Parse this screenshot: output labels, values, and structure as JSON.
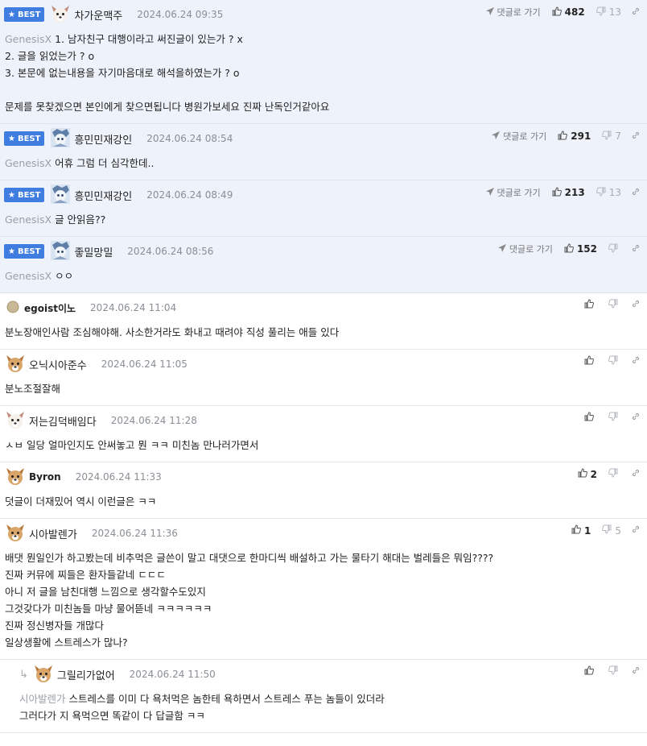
{
  "labels": {
    "best": "BEST",
    "go_to_reply": "댓글로 가기"
  },
  "colors": {
    "best_bg": "#eef3fb",
    "badge": "#3f7de0",
    "mention": "#9aa0a6"
  },
  "comments": [
    {
      "best": true,
      "avatar": "dog-white",
      "nick": "차가운맥주",
      "date": "2024.06.24 09:35",
      "show_go": true,
      "likes": "482",
      "dislikes": "13",
      "mention": "GenesisX",
      "lines": [
        "1. 남자친구 대행이라고 써진글이 있는가 ? x",
        "2. 글을 읽었는가 ? o",
        "3. 본문에 없는내용을 자기마음대로 해석을하였는가 ? o",
        "",
        "문제를 못찾겠으면 본인에게 찾으면됩니다 병원가보세요 진짜 난독인거같아요"
      ]
    },
    {
      "best": true,
      "avatar": "anime",
      "nick": "흥민민재강인",
      "date": "2024.06.24 08:54",
      "show_go": true,
      "likes": "291",
      "dislikes": "7",
      "mention": "GenesisX",
      "lines": [
        "어휴 그럼 더 심각한데.."
      ]
    },
    {
      "best": true,
      "avatar": "anime",
      "nick": "흥민민재강인",
      "date": "2024.06.24 08:49",
      "show_go": true,
      "likes": "213",
      "dislikes": "13",
      "mention": "GenesisX",
      "lines": [
        "글 안읽음??"
      ]
    },
    {
      "best": true,
      "avatar": "anime",
      "nick": "좋밀망밀",
      "date": "2024.06.24 08:56",
      "show_go": true,
      "likes": "152",
      "dislikes": "",
      "mention": "GenesisX",
      "lines": [
        "ㅇㅇ"
      ]
    },
    {
      "best": false,
      "avatar": "circle",
      "nick": "egoist이노",
      "nick_bold": true,
      "date": "2024.06.24 11:04",
      "show_go": false,
      "likes": "",
      "dislikes": "",
      "mention": "",
      "lines": [
        "분노장애인사람 조심해야해. 사소한거라도 화내고 때려야 직성 풀리는 애들 있다"
      ]
    },
    {
      "best": false,
      "avatar": "dog-fawn",
      "nick": "오닉시아준수",
      "date": "2024.06.24 11:05",
      "show_go": false,
      "likes": "",
      "dislikes": "",
      "mention": "",
      "lines": [
        "분노조절잘해"
      ]
    },
    {
      "best": false,
      "avatar": "dog-white",
      "nick": "저는김덕배임다",
      "date": "2024.06.24 11:28",
      "show_go": false,
      "likes": "",
      "dislikes": "",
      "mention": "",
      "lines": [
        "ㅅㅂ 일당 얼마인지도 안써놓고 뭔 ㅋㅋ 미친놈 만나러가면서"
      ]
    },
    {
      "best": false,
      "avatar": "dog-fawn",
      "nick": "Byron",
      "nick_bold": true,
      "date": "2024.06.24 11:33",
      "show_go": false,
      "likes": "2",
      "dislikes": "",
      "mention": "",
      "lines": [
        "덧글이 더재밌어 역시 이런글은 ㅋㅋ"
      ]
    },
    {
      "best": false,
      "avatar": "dog-fawn",
      "nick": "시아발렌가",
      "date": "2024.06.24 11:36",
      "show_go": false,
      "likes": "1",
      "dislikes": "5",
      "mention": "",
      "lines": [
        "배댓 뭔일인가 하고봤는데 비추먹은 글쓴이 말고 대댓으로 한마디씩 배설하고 가는 물타기 해대는 벌레들은 뭐임????",
        "진짜 커뮤에 찌들은 환자들같네 ㄷㄷㄷ",
        "아니 저 글을 남친대행 느낌으로 생각할수도있지",
        "그것갖다가 미친놈들 마냥 물어뜯네 ㅋㅋㅋㅋㅋㅋ",
        "진짜 정신병자들 개많다",
        "일상생활에 스트레스가 많나?"
      ]
    },
    {
      "best": false,
      "reply": true,
      "avatar": "dog-fawn",
      "nick": "그릴리가없어",
      "date": "2024.06.24 11:50",
      "show_go": false,
      "likes": "",
      "dislikes": "",
      "mention": "시아발렌가",
      "lines": [
        "스트레스를 이미 다 욕처먹은 놈한테 욕하면서 스트레스 푸는 놈들이 있더라",
        "그러다가 지 욕먹으면 똑같이 다 답글함 ㅋㅋ"
      ]
    }
  ]
}
